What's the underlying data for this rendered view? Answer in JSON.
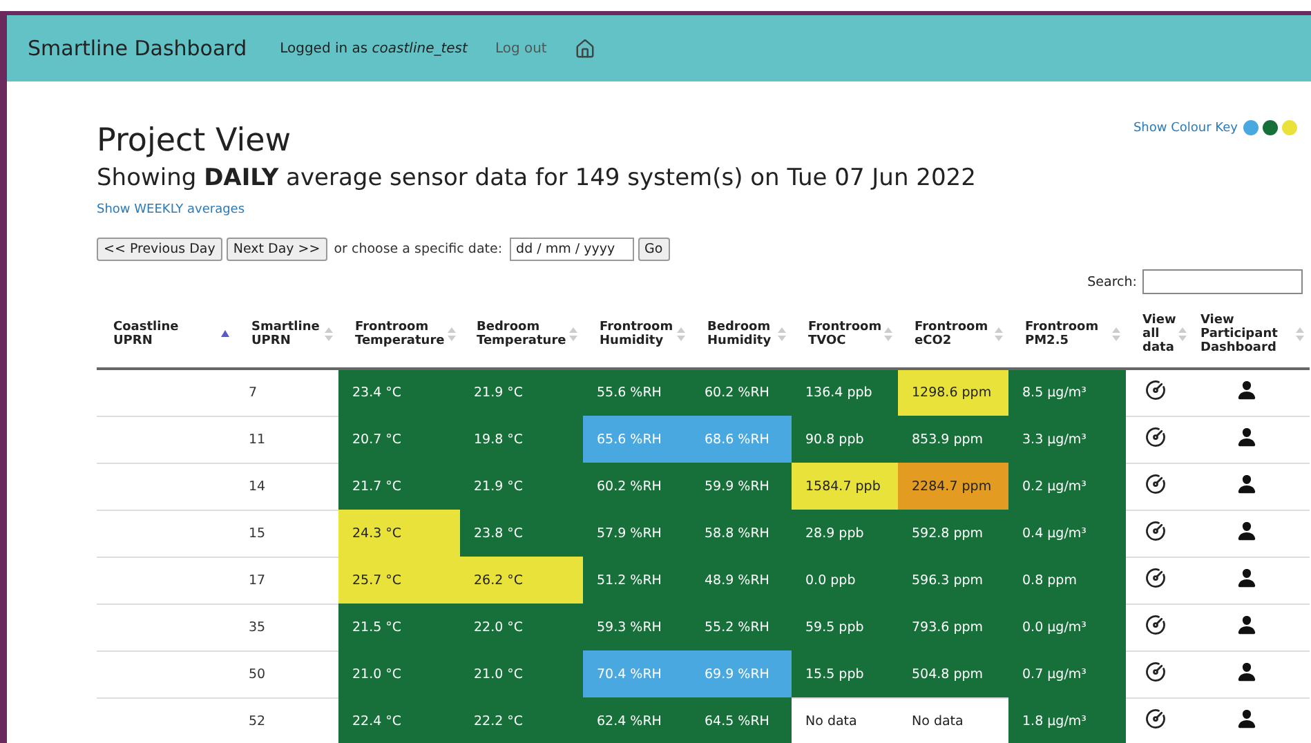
{
  "navbar": {
    "brand": "Smartline Dashboard",
    "logged_in_prefix": "Logged in as ",
    "username": "coastline_test",
    "logout": "Log out"
  },
  "colour_key": {
    "label": "Show Colour Key",
    "dots": [
      {
        "color": "#4aa8e0"
      },
      {
        "color": "#17703a"
      },
      {
        "color": "#e8e23a"
      }
    ]
  },
  "title": "Project View",
  "subtitle": "Showing **DAILY** average sensor data for 149 system(s) on Tue 07 Jun 2022",
  "weekly_link": "Show WEEKLY averages",
  "date_nav": {
    "prev": "<< Previous Day",
    "next": "Next Day >>",
    "or_text": "or choose a specific date:",
    "date_placeholder": "dd / mm / yyyy",
    "go": "Go"
  },
  "search": {
    "label": "Search:"
  },
  "table": {
    "columns": [
      {
        "label": "Coastline UPRN",
        "sorted": true
      },
      {
        "label": "Smartline UPRN",
        "sorted": false
      },
      {
        "label": "Frontroom Temperature",
        "sorted": false
      },
      {
        "label": "Bedroom Temperature",
        "sorted": false
      },
      {
        "label": "Frontroom Humidity",
        "sorted": false
      },
      {
        "label": "Bedroom Humidity",
        "sorted": false
      },
      {
        "label": "Frontroom TVOC",
        "sorted": false
      },
      {
        "label": "Frontroom eCO2",
        "sorted": false
      },
      {
        "label": "Frontroom PM2.5",
        "sorted": false
      },
      {
        "label": "View all data",
        "sorted": false
      },
      {
        "label": "View Participant Dashboard",
        "sorted": false
      }
    ],
    "rows": [
      {
        "cells": [
          {
            "kind": "text",
            "text": ""
          },
          {
            "kind": "text",
            "text": "7"
          },
          {
            "kind": "reading",
            "text": "23.4 °C",
            "color": "#17703a"
          },
          {
            "kind": "reading",
            "text": "21.9 °C",
            "color": "#17703a"
          },
          {
            "kind": "reading",
            "text": "55.6 %RH",
            "color": "#17703a"
          },
          {
            "kind": "reading",
            "text": "60.2 %RH",
            "color": "#17703a"
          },
          {
            "kind": "reading",
            "text": "136.4 ppb",
            "color": "#17703a"
          },
          {
            "kind": "reading",
            "text": "1298.6 ppm",
            "color": "#e8e23a"
          },
          {
            "kind": "reading",
            "text": "8.5 µg/m³",
            "color": "#17703a"
          },
          {
            "kind": "gauge"
          },
          {
            "kind": "person"
          }
        ]
      },
      {
        "cells": [
          {
            "kind": "text",
            "text": ""
          },
          {
            "kind": "text",
            "text": "11"
          },
          {
            "kind": "reading",
            "text": "20.7 °C",
            "color": "#17703a"
          },
          {
            "kind": "reading",
            "text": "19.8 °C",
            "color": "#17703a"
          },
          {
            "kind": "reading",
            "text": "65.6 %RH",
            "color": "#4aa8e0"
          },
          {
            "kind": "reading",
            "text": "68.6 %RH",
            "color": "#4aa8e0"
          },
          {
            "kind": "reading",
            "text": "90.8 ppb",
            "color": "#17703a"
          },
          {
            "kind": "reading",
            "text": "853.9 ppm",
            "color": "#17703a"
          },
          {
            "kind": "reading",
            "text": "3.3 µg/m³",
            "color": "#17703a"
          },
          {
            "kind": "gauge"
          },
          {
            "kind": "person"
          }
        ]
      },
      {
        "cells": [
          {
            "kind": "text",
            "text": ""
          },
          {
            "kind": "text",
            "text": "14"
          },
          {
            "kind": "reading",
            "text": "21.7 °C",
            "color": "#17703a"
          },
          {
            "kind": "reading",
            "text": "21.9 °C",
            "color": "#17703a"
          },
          {
            "kind": "reading",
            "text": "60.2 %RH",
            "color": "#17703a"
          },
          {
            "kind": "reading",
            "text": "59.9 %RH",
            "color": "#17703a"
          },
          {
            "kind": "reading",
            "text": "1584.7 ppb",
            "color": "#e8e23a"
          },
          {
            "kind": "reading",
            "text": "2284.7 ppm",
            "color": "#e39b22"
          },
          {
            "kind": "reading",
            "text": "0.2 µg/m³",
            "color": "#17703a"
          },
          {
            "kind": "gauge"
          },
          {
            "kind": "person"
          }
        ]
      },
      {
        "cells": [
          {
            "kind": "text",
            "text": ""
          },
          {
            "kind": "text",
            "text": "15"
          },
          {
            "kind": "reading",
            "text": "24.3 °C",
            "color": "#e8e23a"
          },
          {
            "kind": "reading",
            "text": "23.8 °C",
            "color": "#17703a"
          },
          {
            "kind": "reading",
            "text": "57.9 %RH",
            "color": "#17703a"
          },
          {
            "kind": "reading",
            "text": "58.8 %RH",
            "color": "#17703a"
          },
          {
            "kind": "reading",
            "text": "28.9 ppb",
            "color": "#17703a"
          },
          {
            "kind": "reading",
            "text": "592.8 ppm",
            "color": "#17703a"
          },
          {
            "kind": "reading",
            "text": "0.4 µg/m³",
            "color": "#17703a"
          },
          {
            "kind": "gauge"
          },
          {
            "kind": "person"
          }
        ]
      },
      {
        "cells": [
          {
            "kind": "text",
            "text": ""
          },
          {
            "kind": "text",
            "text": "17"
          },
          {
            "kind": "reading",
            "text": "25.7 °C",
            "color": "#e8e23a"
          },
          {
            "kind": "reading",
            "text": "26.2 °C",
            "color": "#e8e23a"
          },
          {
            "kind": "reading",
            "text": "51.2 %RH",
            "color": "#17703a"
          },
          {
            "kind": "reading",
            "text": "48.9 %RH",
            "color": "#17703a"
          },
          {
            "kind": "reading",
            "text": "0.0 ppb",
            "color": "#17703a"
          },
          {
            "kind": "reading",
            "text": "596.3 ppm",
            "color": "#17703a"
          },
          {
            "kind": "reading",
            "text": "0.8 ppm",
            "color": "#17703a"
          },
          {
            "kind": "gauge"
          },
          {
            "kind": "person"
          }
        ]
      },
      {
        "cells": [
          {
            "kind": "text",
            "text": ""
          },
          {
            "kind": "text",
            "text": "35"
          },
          {
            "kind": "reading",
            "text": "21.5 °C",
            "color": "#17703a"
          },
          {
            "kind": "reading",
            "text": "22.0 °C",
            "color": "#17703a"
          },
          {
            "kind": "reading",
            "text": "59.3 %RH",
            "color": "#17703a"
          },
          {
            "kind": "reading",
            "text": "55.2 %RH",
            "color": "#17703a"
          },
          {
            "kind": "reading",
            "text": "59.5 ppb",
            "color": "#17703a"
          },
          {
            "kind": "reading",
            "text": "793.6 ppm",
            "color": "#17703a"
          },
          {
            "kind": "reading",
            "text": "0.0 µg/m³",
            "color": "#17703a"
          },
          {
            "kind": "gauge"
          },
          {
            "kind": "person"
          }
        ]
      },
      {
        "cells": [
          {
            "kind": "text",
            "text": ""
          },
          {
            "kind": "text",
            "text": "50"
          },
          {
            "kind": "reading",
            "text": "21.0 °C",
            "color": "#17703a"
          },
          {
            "kind": "reading",
            "text": "21.0 °C",
            "color": "#17703a"
          },
          {
            "kind": "reading",
            "text": "70.4 %RH",
            "color": "#4aa8e0"
          },
          {
            "kind": "reading",
            "text": "69.9 %RH",
            "color": "#4aa8e0"
          },
          {
            "kind": "reading",
            "text": "15.5 ppb",
            "color": "#17703a"
          },
          {
            "kind": "reading",
            "text": "504.8 ppm",
            "color": "#17703a"
          },
          {
            "kind": "reading",
            "text": "0.7 µg/m³",
            "color": "#17703a"
          },
          {
            "kind": "gauge"
          },
          {
            "kind": "person"
          }
        ]
      },
      {
        "cells": [
          {
            "kind": "text",
            "text": ""
          },
          {
            "kind": "text",
            "text": "52"
          },
          {
            "kind": "reading",
            "text": "22.4 °C",
            "color": "#17703a"
          },
          {
            "kind": "reading",
            "text": "22.2 °C",
            "color": "#17703a"
          },
          {
            "kind": "reading",
            "text": "62.4 %RH",
            "color": "#17703a"
          },
          {
            "kind": "reading",
            "text": "64.5 %RH",
            "color": "#17703a"
          },
          {
            "kind": "reading",
            "text": "No data",
            "color": "#ffffff"
          },
          {
            "kind": "reading",
            "text": "No data",
            "color": "#ffffff"
          },
          {
            "kind": "reading",
            "text": "1.8 µg/m³",
            "color": "#17703a"
          },
          {
            "kind": "gauge"
          },
          {
            "kind": "person"
          }
        ]
      }
    ]
  }
}
